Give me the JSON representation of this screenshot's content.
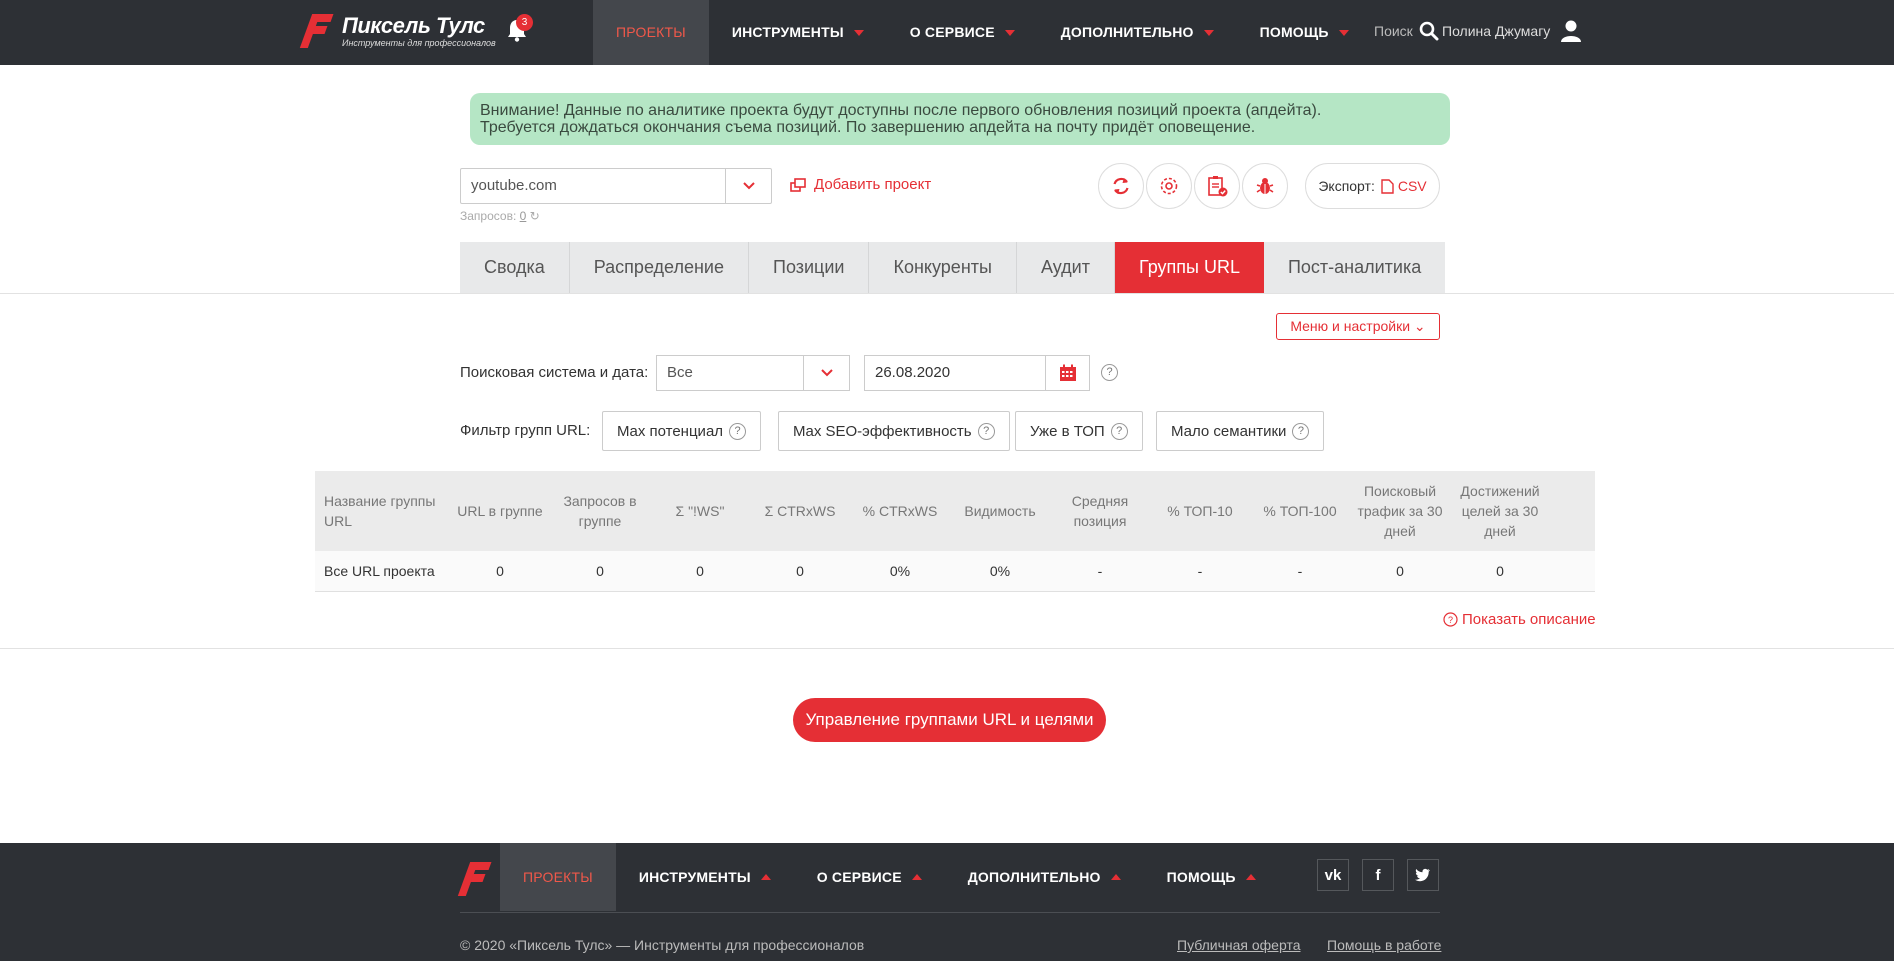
{
  "header": {
    "logo_title": "Пиксель Тулс",
    "logo_subtitle": "Инструменты для профессионалов",
    "notifications_count": "3",
    "nav": [
      {
        "label": "ПРОЕКТЫ"
      },
      {
        "label": "ИНСТРУМЕНТЫ"
      },
      {
        "label": "О СЕРВИСЕ"
      },
      {
        "label": "ДОПОЛНИТЕЛЬНО"
      },
      {
        "label": "ПОМОЩЬ"
      }
    ],
    "search_label": "Поиск",
    "user_name": "Полина Джумагу"
  },
  "alert": {
    "line1": "Внимание! Данные по аналитике проекта будут доступны после первого обновления позиций проекта (апдейта).",
    "line2": "Требуется дождаться окончания съема позиций. По завершению апдейта на почту придёт оповещение."
  },
  "project": {
    "selected": "youtube.com",
    "requests_label": "Запросов:",
    "requests_count": "0",
    "add_label": "Добавить проект",
    "export_label": "Экспорт:",
    "export_format": "CSV"
  },
  "tabs": [
    {
      "label": "Сводка"
    },
    {
      "label": "Распределение"
    },
    {
      "label": "Позиции"
    },
    {
      "label": "Конкуренты"
    },
    {
      "label": "Аудит"
    },
    {
      "label": "Группы URL"
    },
    {
      "label": "Пост-аналитика"
    }
  ],
  "menu_settings": "Меню и настройки",
  "filters": {
    "se_label": "Поисковая система и дата:",
    "se_value": "Все",
    "date_value": "26.08.2020",
    "group_filter_label": "Фильтр групп URL:",
    "buttons": [
      {
        "label": "Max потенциал"
      },
      {
        "label": "Max SEO-эффективность"
      },
      {
        "label": "Уже в ТОП"
      },
      {
        "label": "Мало семантики"
      }
    ],
    "help": "?"
  },
  "table": {
    "headers": [
      "Название группы URL",
      "URL в группе",
      "Запросов в группе",
      "Σ \"!WS\"",
      "Σ CTRxWS",
      "% CTRxWS",
      "Видимость",
      "Средняя позиция",
      "% ТОП-10",
      "% ТОП-100",
      "Поисковый трафик за 30 дней",
      "Достижений целей за 30 дней"
    ],
    "rows": [
      [
        "Все URL проекта",
        "0",
        "0",
        "0",
        "0",
        "0%",
        "0%",
        "-",
        "-",
        "-",
        "0",
        "0"
      ]
    ]
  },
  "show_description": "Показать описание",
  "cta_label": "Управление группами URL и целями",
  "footer": {
    "nav": [
      {
        "label": "ПРОЕКТЫ"
      },
      {
        "label": "ИНСТРУМЕНТЫ"
      },
      {
        "label": "О СЕРВИСЕ"
      },
      {
        "label": "ДОПОЛНИТЕЛЬНО"
      },
      {
        "label": "ПОМОЩЬ"
      }
    ],
    "copyright": "© 2020 «Пиксель Тулс» — Инструменты для профессионалов",
    "offer_link": "Публичная оферта",
    "help_link": "Помощь в работе"
  },
  "colors": {
    "accent": "#e52f35",
    "dark": "#2d3035",
    "alert_bg": "#b5e6c5"
  }
}
